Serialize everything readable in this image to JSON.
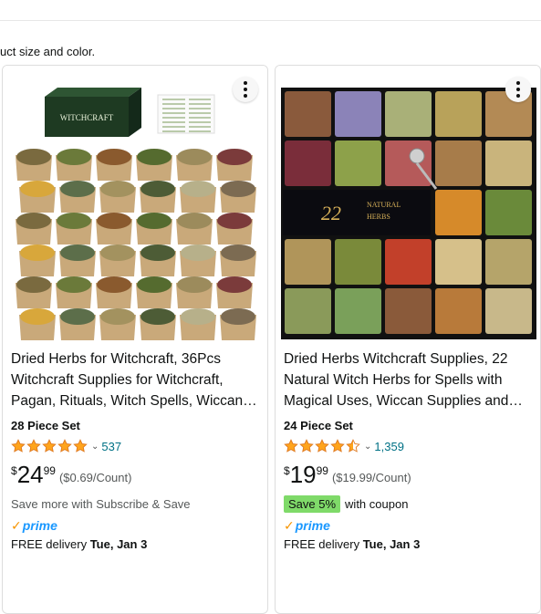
{
  "subtitle": "uct size and color.",
  "products": [
    {
      "title": "Dried Herbs for Witchcraft, 36Pcs Witchcraft Supplies for Witchcraft, Pagan, Rituals, Witch Spells, Wiccan…",
      "badge": "28 Piece Set",
      "rating": 5,
      "review_count": "537",
      "price_symbol": "$",
      "price_whole": "24",
      "price_fraction": "99",
      "unit_price": "($0.69/Count)",
      "line2": "Save more with Subscribe & Save",
      "prime_label": "prime",
      "delivery_prefix": "FREE delivery",
      "delivery_date": "Tue, Jan 3",
      "box_label": "WITCHCRAFT"
    },
    {
      "title": "Dried Herbs Witchcraft Supplies, 22 Natural Witch Herbs for Spells with Magical Uses, Wiccan Supplies and…",
      "badge": "24 Piece Set",
      "rating": 4.5,
      "review_count": "1,359",
      "price_symbol": "$",
      "price_whole": "19",
      "price_fraction": "99",
      "unit_price": "($19.99/Count)",
      "coupon_tag": "Save 5%",
      "coupon_text": "with coupon",
      "prime_label": "prime",
      "delivery_prefix": "FREE delivery",
      "delivery_date": "Tue, Jan 3",
      "box_number": "22",
      "box_label_top": "NATURAL",
      "box_label_bottom": "HERBS"
    }
  ],
  "colors": {
    "star": "#ffa41c",
    "link": "#007185",
    "coupon": "#7fda69",
    "prime_blue": "#1a98ff",
    "prime_check": "#f79400"
  }
}
